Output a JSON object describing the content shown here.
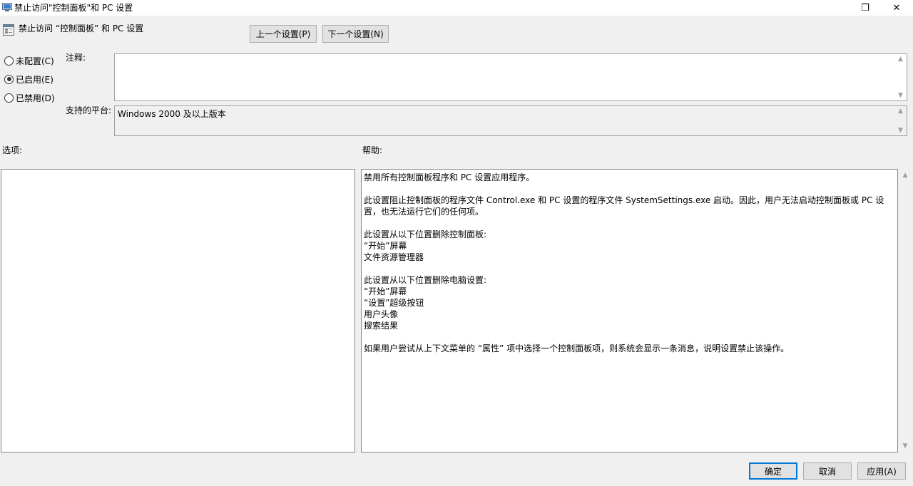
{
  "window": {
    "title": "禁止访问\"控制面板\"和 PC 设置",
    "restore_glyph": "❐",
    "close_glyph": "✕"
  },
  "header": {
    "policy_title": "禁止访问 “控制面板” 和 PC 设置",
    "prev_button": "上一个设置(P)",
    "next_button": "下一个设置(N)"
  },
  "state": {
    "options": [
      {
        "label": "未配置(C)",
        "checked": false
      },
      {
        "label": "已启用(E)",
        "checked": true
      },
      {
        "label": "已禁用(D)",
        "checked": false
      }
    ]
  },
  "comment": {
    "label": "注释:",
    "value": ""
  },
  "platform": {
    "label": "支持的平台:",
    "value": "Windows 2000 及以上版本"
  },
  "options_section": {
    "label": "选项:"
  },
  "help_section": {
    "label": "帮助:",
    "lines": [
      "禁用所有控制面板程序和 PC 设置应用程序。",
      "",
      "此设置阻止控制面板的程序文件 Control.exe 和 PC 设置的程序文件 SystemSettings.exe 启动。因此，用户无法启动控制面板或 PC 设置，也无法运行它们的任何项。",
      "",
      "此设置从以下位置删除控制面板:",
      "“开始”屏幕",
      "文件资源管理器",
      "",
      "此设置从以下位置删除电脑设置:",
      "“开始”屏幕",
      "“设置”超级按钮",
      "用户头像",
      "搜索结果",
      "",
      "如果用户尝试从上下文菜单的 “属性” 项中选择一个控制面板项，则系统会显示一条消息，说明设置禁止该操作。"
    ]
  },
  "footer": {
    "ok": "确定",
    "cancel": "取消",
    "apply": "应用(A)"
  }
}
